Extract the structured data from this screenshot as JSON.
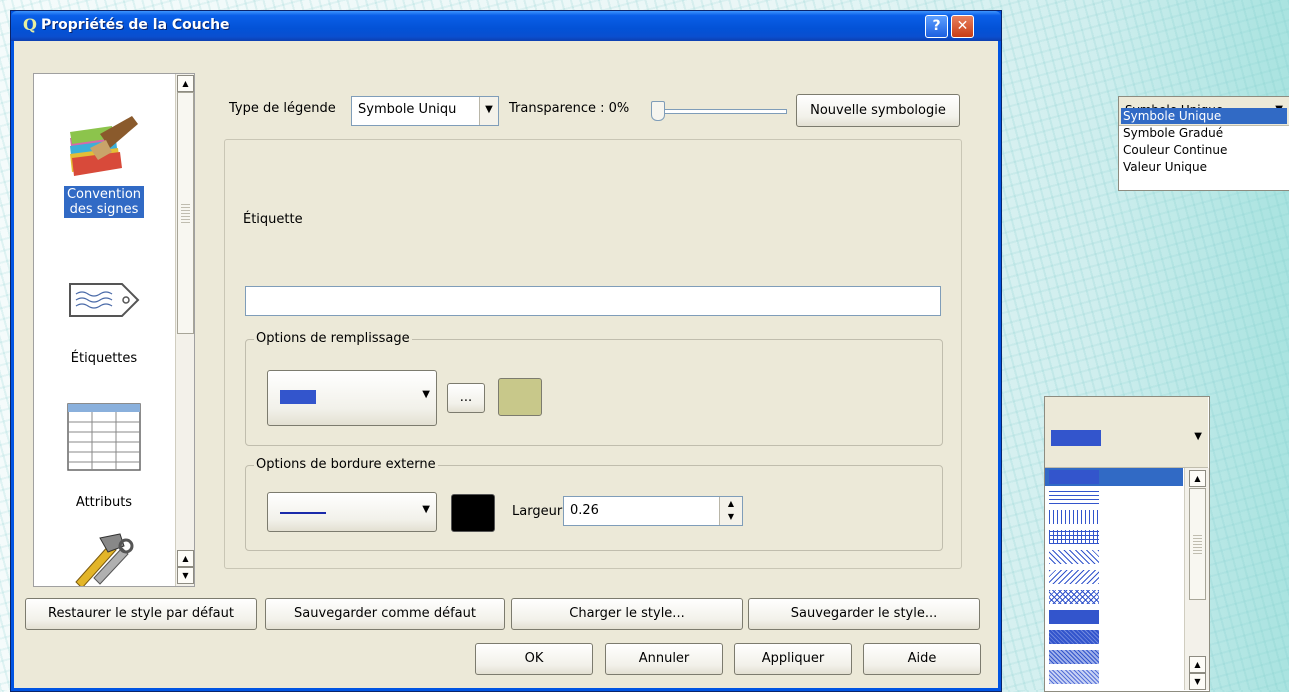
{
  "window": {
    "title": "Propriétés de la Couche",
    "app_icon": "Q",
    "help_label": "?",
    "close_label": "✕"
  },
  "sidebar": {
    "items": [
      {
        "label_lines": [
          "Convention",
          "des signes"
        ],
        "icon": "paintbrush-icon",
        "selected": true
      },
      {
        "label": "Étiquettes",
        "icon": "label-tag-icon"
      },
      {
        "label": "Attributs",
        "icon": "table-icon"
      },
      {
        "label": "",
        "icon": "tools-icon"
      }
    ]
  },
  "toolbar": {
    "legend_type_label": "Type de légende",
    "legend_type_value": "Symbole Uniqu",
    "transparency_label": "Transparence : 0%",
    "transparency_value": 0,
    "new_symbology_label": "Nouvelle symbologie"
  },
  "symbol": {
    "label_caption": "Étiquette",
    "label_value": "",
    "fill_group_title": "Options de remplissage",
    "fill_color": "#3355cc",
    "fill_more_label": "...",
    "fill_swatch_color": "#c8c88a",
    "border_group_title": "Options de bordure externe",
    "border_line_color": "#1a2aaa",
    "border_color": "#000000",
    "width_label": "Largeur",
    "width_value": "0.26"
  },
  "style_buttons": {
    "restore_default": "Restaurer le style par défaut",
    "save_default": "Sauvegarder comme défaut",
    "load_style": "Charger le style...",
    "save_style": "Sauvegarder le style..."
  },
  "dialog_buttons": {
    "ok": "OK",
    "cancel": "Annuler",
    "apply": "Appliquer",
    "help": "Aide"
  },
  "legend_dropdown": {
    "current": "Symbole Unique",
    "options": [
      "Symbole Unique",
      "Symbole Gradué",
      "Couleur Continue",
      "Valeur Unique"
    ],
    "selected_index": 0
  },
  "fill_pattern_dropdown": {
    "current_color": "#3355cc",
    "patterns": [
      "solid",
      "horizontal",
      "vertical",
      "cross",
      "bdiagonal",
      "fdiagonal",
      "diagcross",
      "dense1",
      "dense2",
      "dense3"
    ]
  }
}
